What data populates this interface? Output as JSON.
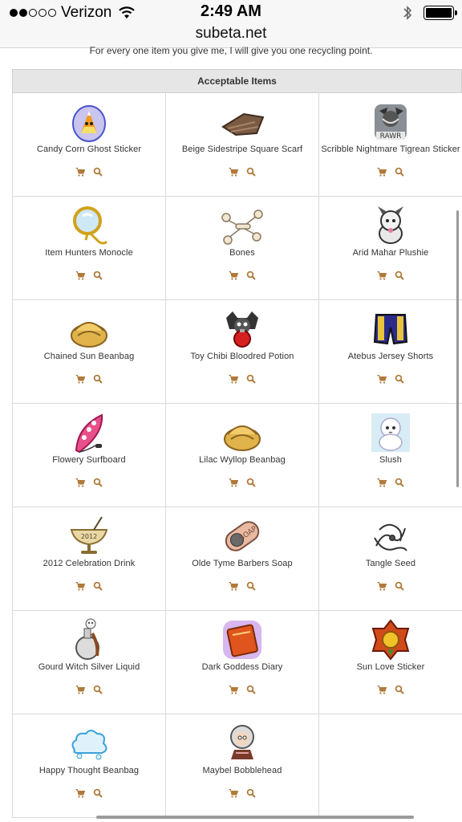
{
  "status": {
    "carrier": "Verizon",
    "time": "2:49 AM",
    "url": "subeta.net",
    "signal_bars": 2
  },
  "page": {
    "intro_text": "For every one item you give me, I will give you one recycling point.",
    "table_title": "Acceptable Items"
  },
  "colors": {
    "action_icon": "#b07a3a",
    "header_bg": "#e6e6e6",
    "border": "#d9d9d9"
  },
  "items": [
    {
      "name": "Candy Corn Ghost Sticker",
      "icon": "candy-corn-ghost-icon"
    },
    {
      "name": "Beige Sidestripe Square Scarf",
      "icon": "scarf-icon"
    },
    {
      "name": "Scribble Nightmare Tigrean Sticker",
      "icon": "tigrean-sticker-icon"
    },
    {
      "name": "Item Hunters Monocle",
      "icon": "monocle-icon"
    },
    {
      "name": "Bones",
      "icon": "bones-icon"
    },
    {
      "name": "Arid Mahar Plushie",
      "icon": "plushie-icon"
    },
    {
      "name": "Chained Sun Beanbag",
      "icon": "beanbag-icon"
    },
    {
      "name": "Toy Chibi Bloodred Potion",
      "icon": "potion-icon"
    },
    {
      "name": "Atebus Jersey Shorts",
      "icon": "shorts-icon"
    },
    {
      "name": "Flowery Surfboard",
      "icon": "surfboard-icon"
    },
    {
      "name": "Lilac Wyllop Beanbag",
      "icon": "beanbag-icon"
    },
    {
      "name": "Slush",
      "icon": "slush-icon"
    },
    {
      "name": "2012 Celebration Drink",
      "icon": "drink-icon"
    },
    {
      "name": "Olde Tyme Barbers Soap",
      "icon": "soap-icon"
    },
    {
      "name": "Tangle Seed",
      "icon": "seed-icon"
    },
    {
      "name": "Gourd Witch Silver Liquid",
      "icon": "liquid-bottle-icon"
    },
    {
      "name": "Dark Goddess Diary",
      "icon": "diary-icon"
    },
    {
      "name": "Sun Love Sticker",
      "icon": "sun-sticker-icon"
    },
    {
      "name": "Happy Thought Beanbag",
      "icon": "cloud-beanbag-icon"
    },
    {
      "name": "Maybel Bobblehead",
      "icon": "bobblehead-icon"
    }
  ]
}
